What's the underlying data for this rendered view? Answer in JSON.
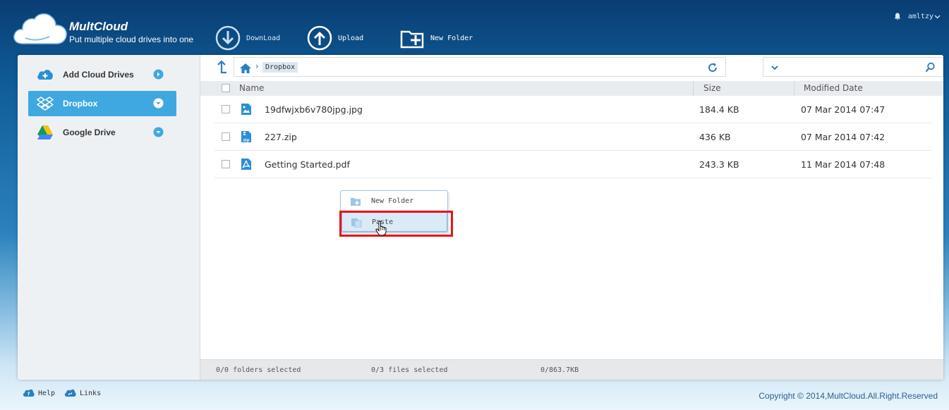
{
  "header": {
    "brand": "MultCloud",
    "tagline": "Put multiple cloud drives into one",
    "toolbar": [
      {
        "label": "DownLoad",
        "icon": "download-icon"
      },
      {
        "label": "Upload",
        "icon": "upload-icon"
      },
      {
        "label": "New Folder",
        "icon": "new-folder-icon"
      }
    ],
    "user": "amltzy"
  },
  "sidebar": {
    "items": [
      {
        "label": "Add Cloud Drives",
        "icon": "add-cloud-icon",
        "active": false
      },
      {
        "label": "Dropbox",
        "icon": "dropbox-icon",
        "active": true
      },
      {
        "label": "Google Drive",
        "icon": "google-drive-icon",
        "active": false
      }
    ]
  },
  "path": {
    "crumbs": [
      "Dropbox"
    ]
  },
  "table": {
    "columns": [
      "Name",
      "Size",
      "Modified Date"
    ],
    "rows": [
      {
        "name": "19dfwjxb6v780jpg.jpg",
        "size": "184.4 KB",
        "date": "07 Mar 2014 07:47",
        "icon": "image-file-icon"
      },
      {
        "name": "227.zip",
        "size": "436 KB",
        "date": "07 Mar 2014 07:42",
        "icon": "zip-file-icon"
      },
      {
        "name": "Getting Started.pdf",
        "size": "243.3 KB",
        "date": "11 Mar 2014 07:48",
        "icon": "pdf-file-icon"
      }
    ]
  },
  "context_menu": {
    "items": [
      {
        "label": "New Folder",
        "icon": "new-folder-icon"
      },
      {
        "label": "Paste",
        "icon": "paste-icon",
        "hovered": true
      }
    ]
  },
  "status": {
    "folders": "0/0 folders selected",
    "files": "0/3 files selected",
    "size": "0/863.7KB"
  },
  "footer": {
    "help": "Help",
    "links": "Links",
    "copyright": "Copyright © 2014,MultCloud.All.Right.Reserved"
  },
  "colors": {
    "accent": "#3fa8e0",
    "highlight": "#e8141a",
    "header_bg": "#0a3d73"
  }
}
